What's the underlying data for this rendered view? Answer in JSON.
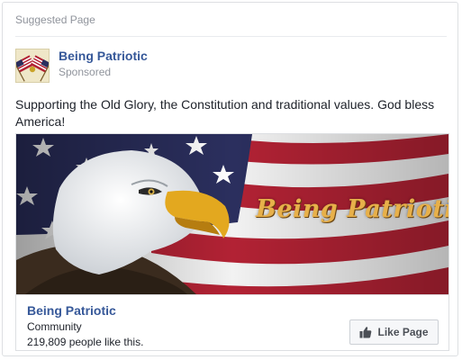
{
  "card": {
    "header_label": "Suggested Page",
    "page_name": "Being Patriotic",
    "sponsored_label": "Sponsored",
    "post_text": "Supporting the Old Glory, the Constitution and traditional values. God bless America!",
    "image_brand_text": "Being Patriotic",
    "footer": {
      "page_name": "Being Patriotic",
      "category": "Community",
      "likes_text": "219,809 people like this.",
      "like_button_label": "Like Page",
      "like_icon": "thumbs-up-icon"
    }
  },
  "colors": {
    "link_blue": "#365899",
    "meta_gray": "#90949c",
    "flag_red": "#b22234",
    "flag_blue": "#2b2f5e",
    "script_gold": "#e7b04a"
  }
}
